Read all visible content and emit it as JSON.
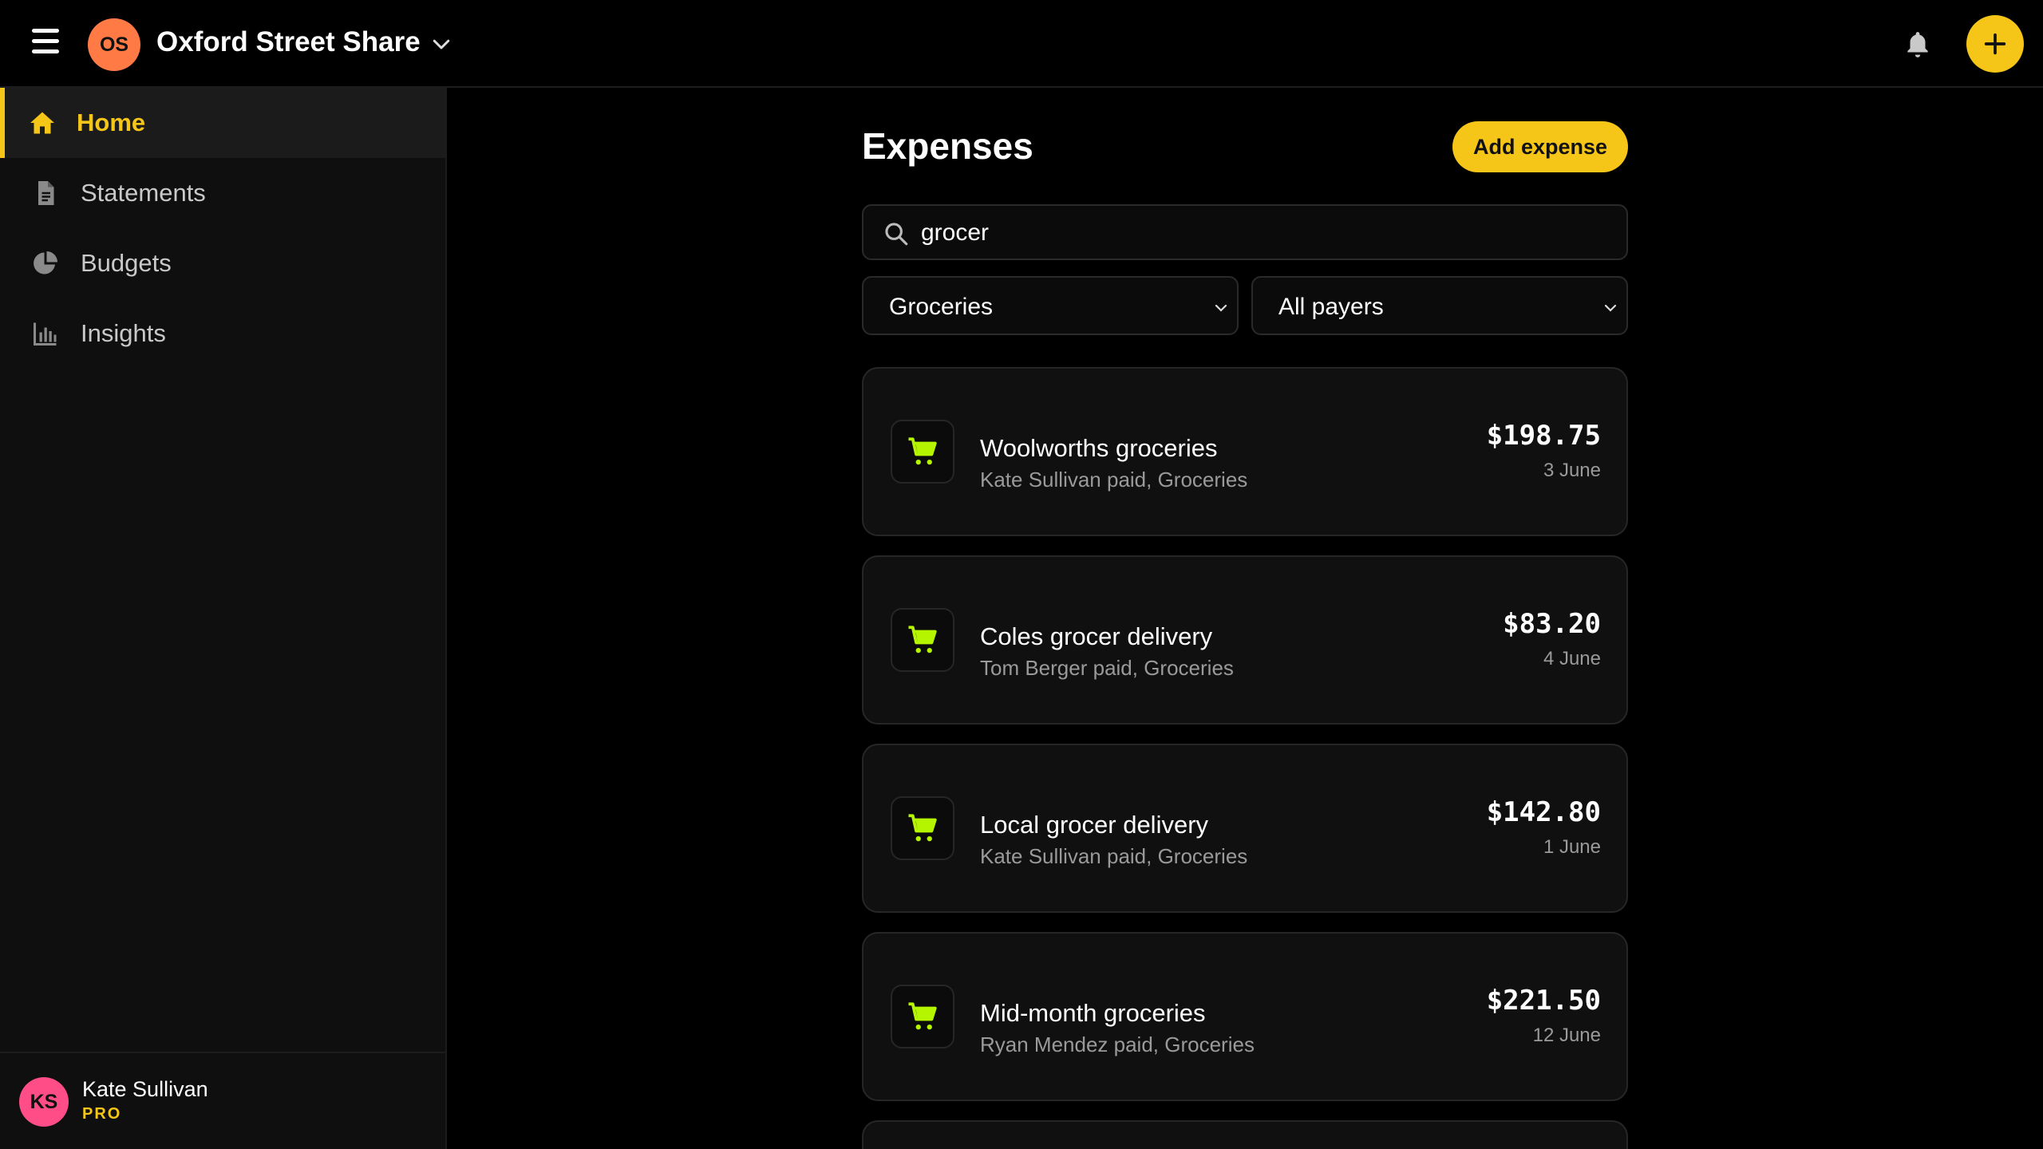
{
  "header": {
    "org_initials": "OS",
    "org_name": "Oxford Street Share"
  },
  "sidebar": {
    "items": [
      {
        "label": "Home",
        "icon": "home-icon",
        "active": true
      },
      {
        "label": "Statements",
        "icon": "document-icon",
        "active": false
      },
      {
        "label": "Budgets",
        "icon": "pie-chart-icon",
        "active": false
      },
      {
        "label": "Insights",
        "icon": "bar-chart-icon",
        "active": false
      }
    ],
    "user": {
      "initials": "KS",
      "name": "Kate Sullivan",
      "plan": "PRO"
    }
  },
  "main": {
    "title": "Expenses",
    "add_label": "Add expense",
    "search": {
      "value": "grocer"
    },
    "filters": {
      "category": "Groceries",
      "payer": "All payers"
    },
    "expenses": [
      {
        "title": "Woolworths groceries",
        "subtitle": "Kate Sullivan paid, Groceries",
        "amount": "$198.75",
        "date": "3 June"
      },
      {
        "title": "Coles grocer delivery",
        "subtitle": "Tom Berger paid, Groceries",
        "amount": "$83.20",
        "date": "4 June"
      },
      {
        "title": "Local grocer delivery",
        "subtitle": "Kate Sullivan paid, Groceries",
        "amount": "$142.80",
        "date": "1 June"
      },
      {
        "title": "Mid-month groceries",
        "subtitle": "Ryan Mendez paid, Groceries",
        "amount": "$221.50",
        "date": "12 June"
      }
    ]
  },
  "colors": {
    "accent": "#f5c518",
    "org_avatar": "#ff7a45",
    "user_avatar": "#ff4d88",
    "cart_icon": "#b6f500"
  }
}
